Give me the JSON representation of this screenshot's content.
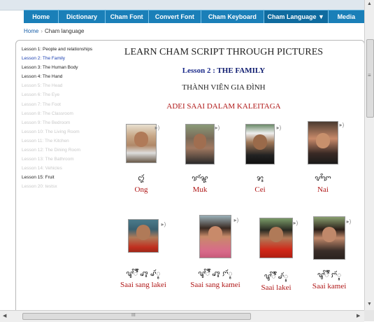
{
  "nav": {
    "items": [
      {
        "label": "Home"
      },
      {
        "label": "Dictionary"
      },
      {
        "label": "Cham Font"
      },
      {
        "label": "Convert Font"
      },
      {
        "label": "Cham Keyboard"
      },
      {
        "label": "Cham Language ▼"
      },
      {
        "label": "Media"
      }
    ]
  },
  "breadcrumb": {
    "home": "Home",
    "sep": "›",
    "current": "Cham language"
  },
  "sidebar": {
    "lessons": [
      {
        "label": "Lesson 1: People and relationships"
      },
      {
        "label": "Lesson 2: The Family"
      },
      {
        "label": "Lesson 3: The Human Body"
      },
      {
        "label": "Lesson 4: The Hand"
      },
      {
        "label": "Lesson 5: The Head"
      },
      {
        "label": "Lesson 6: The Eye"
      },
      {
        "label": "Lesson 7: The Foot"
      },
      {
        "label": "Lesson 8: The Classroom"
      },
      {
        "label": "Lesson 9: The Bedroom"
      },
      {
        "label": "Lesson 10: The Living Room"
      },
      {
        "label": "Lesson 11: The Kitchen"
      },
      {
        "label": "Lesson 12: The Dining Room"
      },
      {
        "label": "Lesson 13: The Bathroom"
      },
      {
        "label": "Lesson 14: Vehicles"
      },
      {
        "label": "Lesson 15: Fruit"
      },
      {
        "label": "Lesson 20: testsx"
      }
    ]
  },
  "main": {
    "title": "LEARN CHAM SCRIPT THROUGH PICTURES",
    "lesson_prefix": "Lesson 2 :",
    "lesson_name": "THE FAMILY",
    "vn_title": "THÀNH VIÊN GIA ĐÌNH",
    "cham_title": "ADEI SAAI DALAM KALEITAGA",
    "speaker_icon": "speaker-icon",
    "cards": [
      {
        "cham": "ꨁꨮ",
        "word": "Ong"
      },
      {
        "cham": "ꨢꨮꨘ",
        "word": "Muk"
      },
      {
        "cham": "ꨌꨶ",
        "word": "Cei"
      },
      {
        "cham": "ꨖꨩꨢ",
        "word": "Nai"
      },
      {
        "cham": "ꨥꨩꨫꨩ ꨨꨶ ꨣꨮꨶ",
        "word": "Saai sang lakei"
      },
      {
        "cham": "ꨥꨩꨫꨩ ꨨꨶ ꨆꨮꨶ",
        "word": "Saai sang kamei"
      },
      {
        "cham": "ꨥꨩꨫꨩ ꨣꨮꨶ",
        "word": "Saai lakei"
      },
      {
        "cham": "ꨥꨩꨫꨩ ꨆꨮꨶ",
        "word": "Saai kamei"
      }
    ]
  },
  "scrollbar": {
    "grip": "III",
    "grip_v": "≡"
  }
}
